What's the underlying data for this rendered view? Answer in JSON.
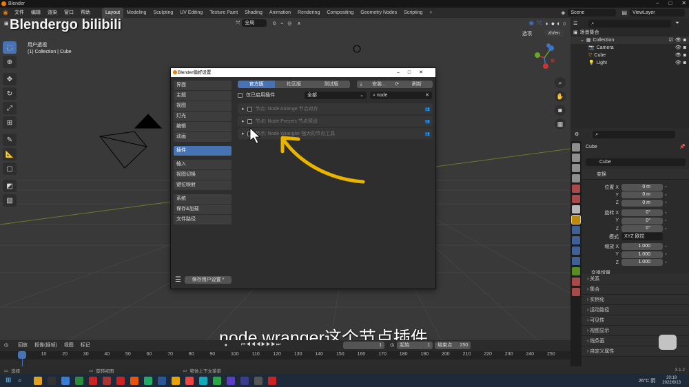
{
  "window": {
    "title": "Blender"
  },
  "topbar": {
    "menus": [
      "文件",
      "编辑",
      "渲染",
      "窗口",
      "帮助"
    ],
    "workspaces": [
      "Layout",
      "Modeling",
      "Sculpting",
      "UV Editing",
      "Texture Paint",
      "Shading",
      "Animation",
      "Rendering",
      "Compositing",
      "Geometry Nodes",
      "Scripting"
    ],
    "active_workspace": "Layout",
    "plus": "+",
    "scene": "Scene",
    "viewlayer": "ViewLayer"
  },
  "viewport": {
    "orientation": "全局",
    "view_label": "用户透视",
    "collection_label": "(1) Collection | Cube",
    "options_label": "选项",
    "lang_button": "zh/en"
  },
  "watermark": {
    "text": "Blendergo bilibili"
  },
  "subtitle": {
    "text": "node wranger这个节点插件"
  },
  "dialog": {
    "title": "Blender偏好设置",
    "sidebar_groups": [
      [
        "界面",
        "主题",
        "视图",
        "灯光",
        "编辑",
        "动画"
      ],
      [
        "插件"
      ],
      [
        "输入",
        "视图切换",
        "键位映射"
      ],
      [
        "系统",
        "保存&加载",
        "文件路径"
      ]
    ],
    "active_item": "插件",
    "tabs": [
      "官方版",
      "社区版",
      "测试版"
    ],
    "active_tab": "官方版",
    "install_label": "安装...",
    "refresh_label": "刷新",
    "enabled_only_label": "仅已启用插件",
    "category": "全部",
    "search_value": "node",
    "addons": [
      {
        "name": "节点: Node Arrange  节点对齐"
      },
      {
        "name": "节点: Node Presets 节点预设"
      },
      {
        "name": "节点: Node Wrangler  强大的节点工具"
      }
    ],
    "save_prefs_label": "保存用户设置 *"
  },
  "outliner": {
    "search_placeholder": "",
    "root": "场景集合",
    "collection": "Collection",
    "items": [
      "Camera",
      "Cube",
      "Light"
    ]
  },
  "properties": {
    "object_name": "Cube",
    "datablock": "Cube",
    "transform_label": "变换",
    "location_label": "位置 X",
    "rotation_label": "旋转 X",
    "scale_label": "缩放 X",
    "axes": [
      "Y",
      "Z"
    ],
    "location": [
      "0 m",
      "0 m",
      "0 m"
    ],
    "rotation": [
      "0°",
      "0°",
      "0°"
    ],
    "scale": [
      "1.000",
      "1.000",
      "1.000"
    ],
    "mode_label": "模式",
    "mode_value": "XYZ 欧拉",
    "delta_label": "变换增量",
    "sections": [
      "关系",
      "集合",
      "实例化",
      "运动路径",
      "可见性",
      "视图显示",
      "线条画",
      "自定义属性"
    ]
  },
  "timeline": {
    "playback": "回放",
    "keying": "抠像(插帧)",
    "view": "视图",
    "marker": "标记",
    "current_frame": "1",
    "start_label": "起始",
    "start": "1",
    "end_label": "结束点",
    "end": "250",
    "ticks": [
      "1",
      "10",
      "20",
      "30",
      "40",
      "50",
      "60",
      "70",
      "80",
      "90",
      "100",
      "110",
      "120",
      "130",
      "140",
      "150",
      "160",
      "170",
      "180",
      "190",
      "200",
      "210",
      "220",
      "230",
      "240",
      "250"
    ]
  },
  "statusbar": {
    "select": "选择",
    "rotate": "旋转视图",
    "context": "物体上下文菜单",
    "version": "3.1.2"
  },
  "taskbar": {
    "weather": "26°C 阴",
    "time": "20:19",
    "date": "2022/6/13"
  },
  "colors": {
    "accent": "#4772b3",
    "orange": "#e8a300"
  }
}
